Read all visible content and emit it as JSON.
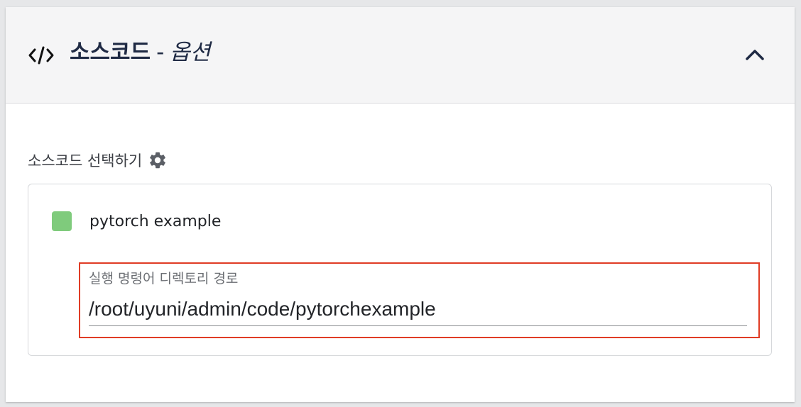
{
  "header": {
    "title": "소스코드",
    "separator": "-",
    "subtitle": "옵션",
    "icon": "code-icon",
    "collapse_icon": "chevron-up-icon"
  },
  "section": {
    "label": "소스코드 선택하기",
    "settings_icon": "gear-icon"
  },
  "source": {
    "name": "pytorch example",
    "swatch_color": "#7fcb7c",
    "field": {
      "label": "실행 명령어 디렉토리 경로",
      "value": "/root/uyuni/admin/code/pytorchexample",
      "highlight_color": "#e03c25"
    }
  }
}
